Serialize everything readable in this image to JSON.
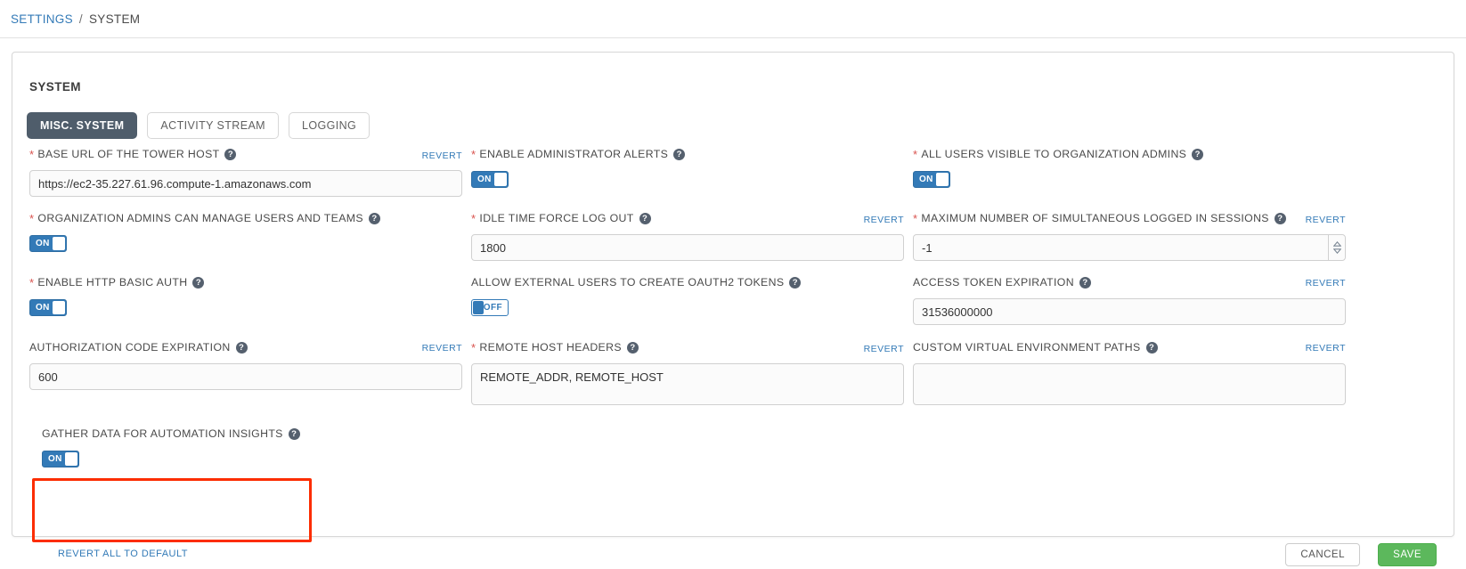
{
  "breadcrumb": {
    "root": "SETTINGS",
    "separator": "/",
    "current": "SYSTEM"
  },
  "card": {
    "title": "SYSTEM"
  },
  "tabs": [
    {
      "label": "MISC. SYSTEM",
      "active": true
    },
    {
      "label": "ACTIVITY STREAM",
      "active": false
    },
    {
      "label": "LOGGING",
      "active": false
    }
  ],
  "common": {
    "revert": "REVERT",
    "help_icon": "question-circle-icon",
    "required_marker": "*"
  },
  "fields": {
    "base_url": {
      "label": "BASE URL OF THE TOWER HOST",
      "required": true,
      "revert": "REVERT",
      "value": "https://ec2-35.227.61.96.compute-1.amazonaws.com"
    },
    "org_admins_manage": {
      "label": "ORGANIZATION ADMINS CAN MANAGE USERS AND TEAMS",
      "required": true,
      "toggle": "ON"
    },
    "http_basic_auth": {
      "label": "ENABLE HTTP BASIC AUTH",
      "required": true,
      "toggle": "ON"
    },
    "auth_code_expiration": {
      "label": "AUTHORIZATION CODE EXPIRATION",
      "required": false,
      "revert": "REVERT",
      "value": "600"
    },
    "gather_data": {
      "label": "GATHER DATA FOR AUTOMATION INSIGHTS",
      "required": false,
      "toggle": "ON"
    },
    "admin_alerts": {
      "label": "ENABLE ADMINISTRATOR ALERTS",
      "required": true,
      "toggle": "ON"
    },
    "idle_time": {
      "label": "IDLE TIME FORCE LOG OUT",
      "required": true,
      "revert": "REVERT",
      "value": "1800"
    },
    "oauth2_tokens": {
      "label": "ALLOW EXTERNAL USERS TO CREATE OAUTH2 TOKENS",
      "required": false,
      "toggle": "OFF"
    },
    "remote_host_headers": {
      "label": "REMOTE HOST HEADERS",
      "required": true,
      "revert": "REVERT",
      "value": "REMOTE_ADDR, REMOTE_HOST"
    },
    "all_users_visible": {
      "label": "ALL USERS VISIBLE TO ORGANIZATION ADMINS",
      "required": true,
      "toggle": "ON"
    },
    "max_sessions": {
      "label": "MAXIMUM NUMBER OF SIMULTANEOUS LOGGED IN SESSIONS",
      "required": true,
      "revert": "REVERT",
      "value": "-1"
    },
    "access_token_expiration": {
      "label": "ACCESS TOKEN EXPIRATION",
      "required": false,
      "revert": "REVERT",
      "value": "31536000000"
    },
    "custom_venv_paths": {
      "label": "CUSTOM VIRTUAL ENVIRONMENT PATHS",
      "required": false,
      "revert": "REVERT",
      "value": ""
    }
  },
  "footer": {
    "revert_all": "REVERT ALL TO DEFAULT",
    "cancel": "CANCEL",
    "save": "SAVE"
  },
  "annotation": {
    "highlight_color": "#fc2d00",
    "target": "gather-data-field"
  },
  "colors": {
    "link": "#337ab7",
    "toggle_on": "#337ab7",
    "save_green": "#5cb85c",
    "tab_active": "#4f5d6b",
    "required_red": "#d9534f"
  }
}
